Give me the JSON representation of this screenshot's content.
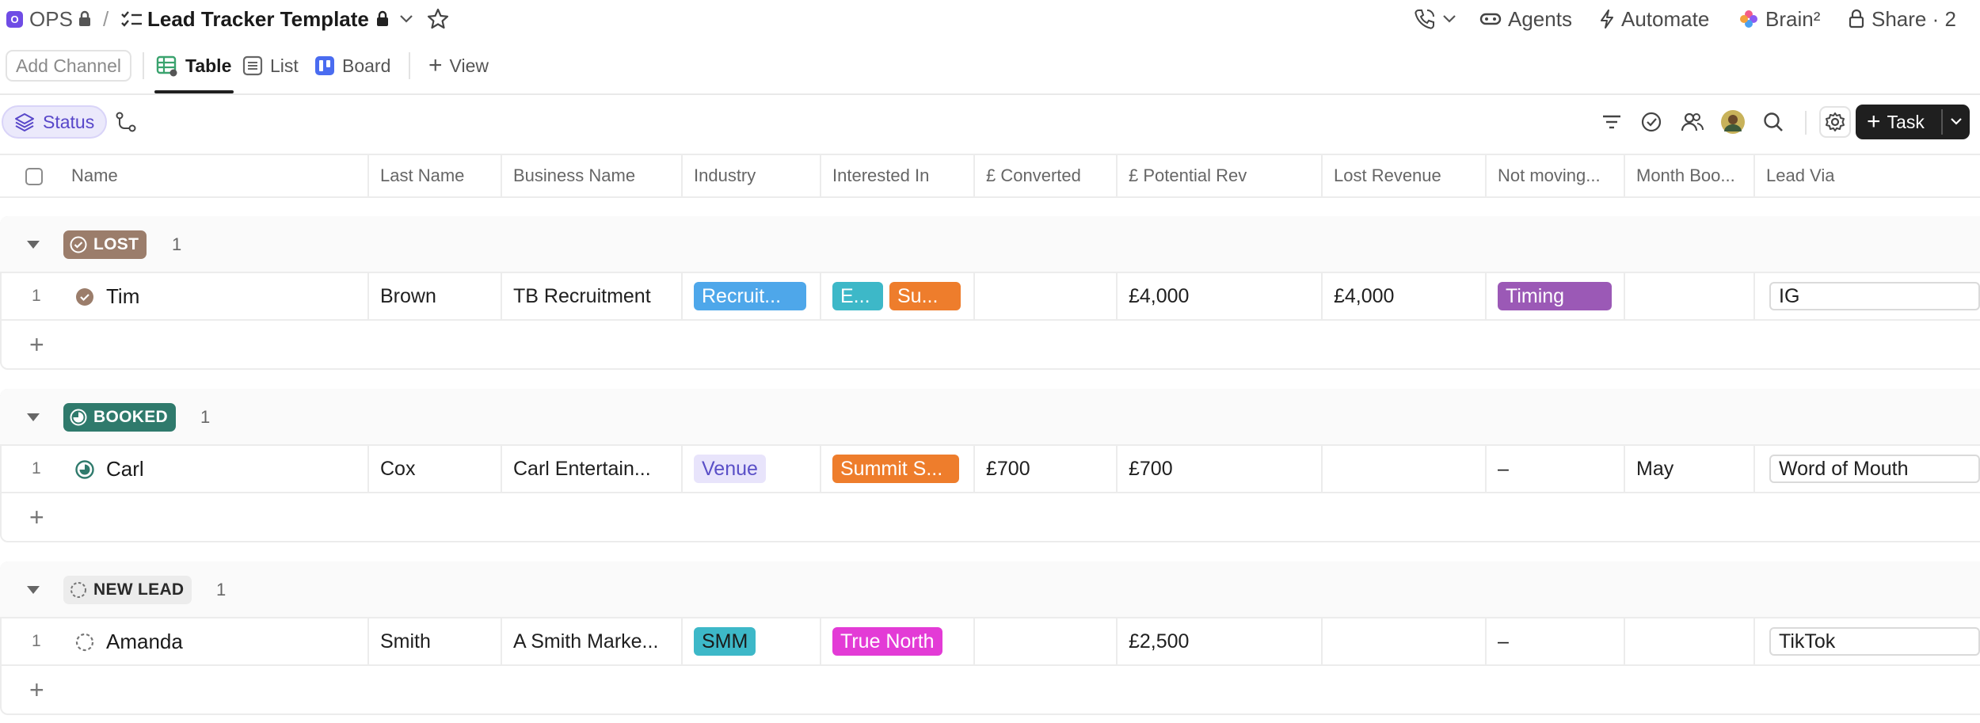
{
  "breadcrumb": {
    "workspace_badge": "O",
    "workspace": "OPS",
    "separator": "/",
    "list_title": "Lead Tracker Template"
  },
  "top_actions": {
    "agents": "Agents",
    "automate": "Automate",
    "brain": "Brain²",
    "share": "Share · 2"
  },
  "tabs": {
    "add_channel": "Add Channel",
    "items": [
      {
        "label": "Table",
        "active": true
      },
      {
        "label": "List",
        "active": false
      },
      {
        "label": "Board",
        "active": false
      }
    ],
    "add_view": "View"
  },
  "toolbar": {
    "status_filter": "Status",
    "task_button": "Task"
  },
  "columns": [
    "Name",
    "Last Name",
    "Business Name",
    "Industry",
    "Interested In",
    "£ Converted",
    "£ Potential Rev",
    "Lost Revenue",
    "Not moving...",
    "Month Boo...",
    "Lead Via"
  ],
  "groups": [
    {
      "status": "LOST",
      "status_color": "#9b7d6b",
      "count": "1",
      "rows": [
        {
          "num": "1",
          "name": "Tim",
          "last_name": "Brown",
          "business": "TB Recruitment",
          "industry": {
            "label": "Recruit...",
            "color": "#4ea7ea"
          },
          "interested": [
            {
              "label": "E...",
              "color": "#3db8c8"
            },
            {
              "label": "Su...",
              "color": "#ee7d2c"
            }
          ],
          "converted": "",
          "potential": "£4,000",
          "lost": "£4,000",
          "not_moving": {
            "label": "Timing",
            "color": "#9b59b6"
          },
          "month": "",
          "lead_via": "IG"
        }
      ]
    },
    {
      "status": "BOOKED",
      "status_color": "#2f7a6c",
      "count": "1",
      "rows": [
        {
          "num": "1",
          "name": "Carl",
          "last_name": "Cox",
          "business": "Carl Entertain...",
          "industry": {
            "label": "Venue",
            "color": "#e8e4fb",
            "text_color": "#5a4fc7"
          },
          "interested": [
            {
              "label": "Summit S...",
              "color": "#ee7d2c"
            }
          ],
          "converted": "£700",
          "potential": "£700",
          "lost": "",
          "not_moving": {
            "label": "–",
            "color": ""
          },
          "month": "May",
          "lead_via": "Word of Mouth"
        }
      ]
    },
    {
      "status": "NEW LEAD",
      "status_color": "#ececec",
      "count": "1",
      "rows": [
        {
          "num": "1",
          "name": "Amanda",
          "last_name": "Smith",
          "business": "A Smith Marke...",
          "industry": {
            "label": "SMM",
            "color": "#3db8c8",
            "text_color": "#1a1a1a"
          },
          "interested": [
            {
              "label": "True North",
              "color": "#e33bd6"
            }
          ],
          "converted": "",
          "potential": "£2,500",
          "lost": "",
          "not_moving": {
            "label": "–",
            "color": ""
          },
          "month": "",
          "lead_via": "TikTok"
        }
      ]
    }
  ]
}
